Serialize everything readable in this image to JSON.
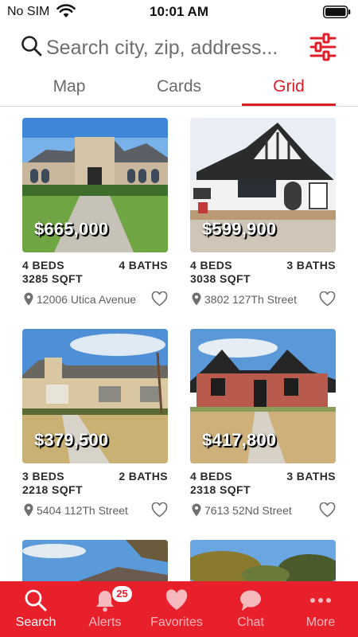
{
  "status_bar": {
    "carrier": "No SIM",
    "time": "10:01 AM"
  },
  "search": {
    "placeholder": "Search city, zip, address..."
  },
  "tabs": [
    {
      "label": "Map"
    },
    {
      "label": "Cards"
    },
    {
      "label": "Grid",
      "active": true
    }
  ],
  "listings": [
    {
      "price": "$665,000",
      "beds": "4 BEDS",
      "baths": "4 BATHS",
      "sqft": "3285 SQFT",
      "address": "12006 Utica Avenue"
    },
    {
      "price": "$599,900",
      "beds": "4 BEDS",
      "baths": "3 BATHS",
      "sqft": "3038 SQFT",
      "address": "3802 127Th Street"
    },
    {
      "price": "$379,500",
      "beds": "3 BEDS",
      "baths": "2 BATHS",
      "sqft": "2218 SQFT",
      "address": "5404 112Th Street"
    },
    {
      "price": "$417,800",
      "beds": "4 BEDS",
      "baths": "3 BATHS",
      "sqft": "2318 SQFT",
      "address": "7613 52Nd Street"
    }
  ],
  "bottom_nav": {
    "items": [
      {
        "label": "Search",
        "icon": "search-icon",
        "active": true
      },
      {
        "label": "Alerts",
        "icon": "bell-icon",
        "badge": "25"
      },
      {
        "label": "Favorites",
        "icon": "heart-icon"
      },
      {
        "label": "Chat",
        "icon": "chat-bubble-icon"
      },
      {
        "label": "More",
        "icon": "more-dots-icon"
      }
    ]
  },
  "colors": {
    "accent": "#e21d2a",
    "nav_background": "#e8202b",
    "text_muted": "#6a6a6a"
  }
}
